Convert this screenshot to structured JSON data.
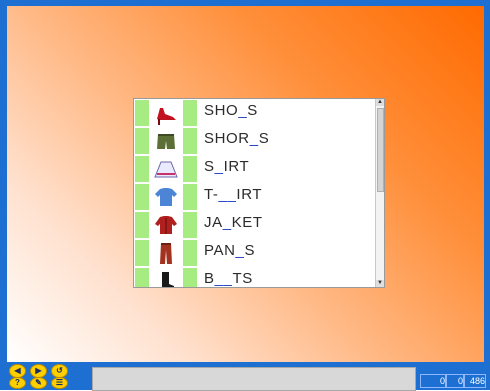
{
  "words": [
    {
      "parts": [
        "SHO",
        "_",
        "S"
      ],
      "icon": "red-heeled-shoe-icon"
    },
    {
      "parts": [
        "SHOR",
        "_",
        "S"
      ],
      "icon": "shorts-icon"
    },
    {
      "parts": [
        "S",
        "_",
        "IRT"
      ],
      "icon": "skirt-icon"
    },
    {
      "parts": [
        "T-",
        "__",
        "IRT"
      ],
      "icon": "tshirt-icon"
    },
    {
      "parts": [
        "JA",
        "_",
        "KET"
      ],
      "icon": "jacket-icon"
    },
    {
      "parts": [
        "PAN",
        "_",
        "S"
      ],
      "icon": "pants-icon"
    },
    {
      "parts": [
        "B",
        "__",
        "TS"
      ],
      "icon": "boots-icon"
    }
  ],
  "counters": {
    "value1": "0",
    "value2": "0",
    "value3": "486"
  },
  "colors": {
    "background_accent": "#ff6a00",
    "frame": "#1d6fd1",
    "green_tile": "#a6ec82"
  }
}
